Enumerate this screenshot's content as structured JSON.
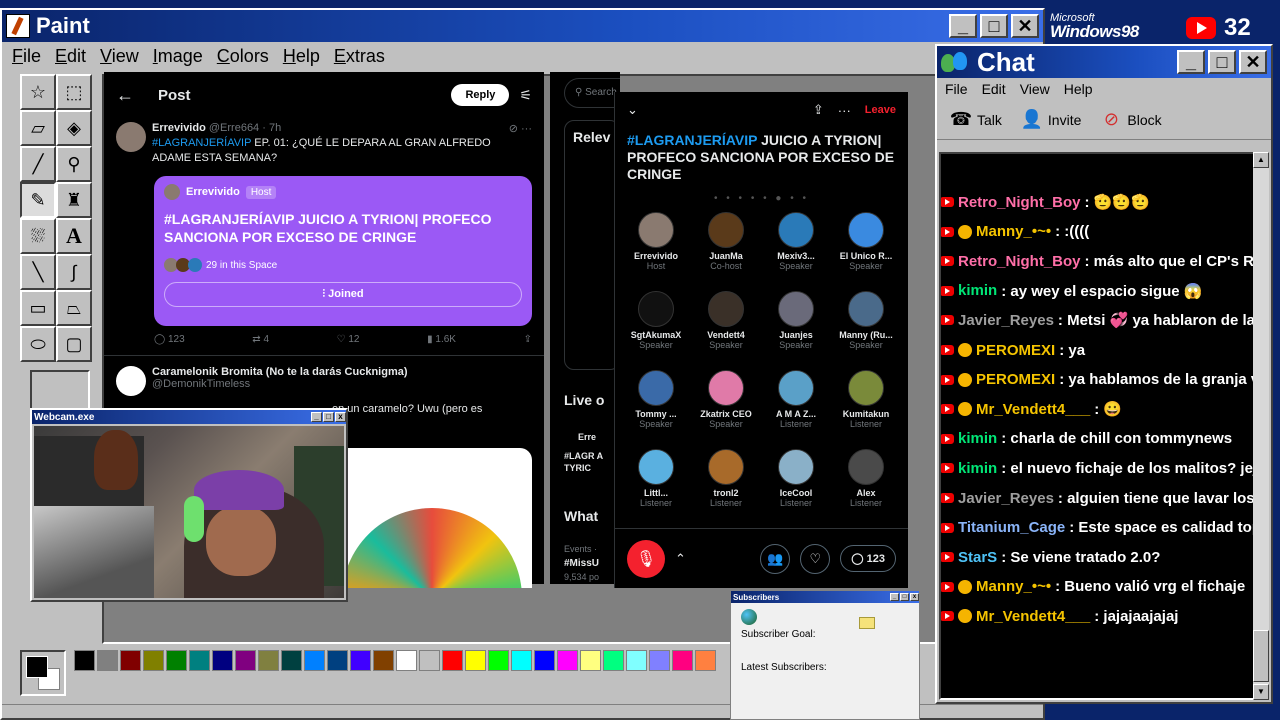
{
  "paint": {
    "title": "Paint",
    "menu": [
      "File",
      "Edit",
      "View",
      "Image",
      "Colors",
      "Help",
      "Extras"
    ],
    "tools": [
      "free-select",
      "rect-select",
      "eraser",
      "fill",
      "color-picker",
      "magnifier",
      "pencil",
      "brush",
      "airbrush",
      "text",
      "line",
      "curve",
      "rectangle",
      "polygon",
      "ellipse",
      "rounded-rect"
    ],
    "palette": [
      "#000000",
      "#808080",
      "#800000",
      "#808000",
      "#008000",
      "#008080",
      "#000080",
      "#800080",
      "#808040",
      "#004040",
      "#0080ff",
      "#004080",
      "#4000ff",
      "#804000",
      "#ffffff",
      "#c0c0c0",
      "#ff0000",
      "#ffff00",
      "#00ff00",
      "#00ffff",
      "#0000ff",
      "#ff00ff",
      "#ffff80",
      "#00ff80",
      "#80ffff",
      "#8080ff",
      "#ff0080",
      "#ff8040"
    ]
  },
  "x_post": {
    "header_title": "Post",
    "reply_label": "Reply",
    "tweet1": {
      "name": "Errevivido",
      "handle": "@Erre664 · 7h",
      "tag": "#LAGRANJERÍAVIP",
      "text": " EP. 01: ¿QUÉ LE DEPARA AL GRAN ALFREDO ADAME ESTA SEMANA?",
      "card_host": "Errevivido",
      "card_host_badge": "Host",
      "card_title": "#LAGRANJERÍAVIP JUICIO A TYRION| PROFECO SANCIONA POR EXCESO DE CRINGE",
      "card_listeners": "29 in this Space",
      "card_joined": "Joined",
      "actions": [
        "123",
        "4",
        "12",
        "1.6K"
      ]
    },
    "tweet2": {
      "name": "Caramelonik Bromita (No te la darás Cucknigma)",
      "handle": "@DemonikTimeless",
      "text": "en un caramelo? Uwu (pero es"
    }
  },
  "x_right": {
    "search": "Search",
    "box1": "Relev",
    "box2": "Live o",
    "box2_name": "Erre",
    "box2_text": "#LAGR A TYRIC",
    "box3": "What",
    "box3_sub": "Events ·",
    "box3_tag": "#MissU",
    "box3_count": "9,534 po"
  },
  "space": {
    "leave": "Leave",
    "tag": "#LAGRANJERÍAVIP",
    "title": " JUICIO A TYRION| PROFECO SANCIONA POR EXCESO DE CRINGE",
    "dots": "• • • • • ● • •",
    "participants": [
      {
        "name": "Errevivido",
        "role": "Host",
        "color": "#8a7a70"
      },
      {
        "name": "JuanMa",
        "role": "Co-host",
        "color": "#5a3a1a"
      },
      {
        "name": "Mexiv3...",
        "role": "Speaker",
        "color": "#2a7ab8"
      },
      {
        "name": "El Unico R...",
        "role": "Speaker",
        "color": "#3a8ae0"
      },
      {
        "name": "SgtAkumaX",
        "role": "Speaker",
        "color": "#111111"
      },
      {
        "name": "Vendett4",
        "role": "Speaker",
        "color": "#3a3028"
      },
      {
        "name": "Juanjes",
        "role": "Speaker",
        "color": "#6a6a7a"
      },
      {
        "name": "Manny (Ru...",
        "role": "Speaker",
        "color": "#4a6a8a"
      },
      {
        "name": "Tommy ...",
        "role": "Speaker",
        "color": "#3a6aa8"
      },
      {
        "name": "Zkatrix CEO",
        "role": "Speaker",
        "color": "#e07aa8"
      },
      {
        "name": "A M A Z...",
        "role": "Listener",
        "color": "#5aa0c8"
      },
      {
        "name": "Kumitakun",
        "role": "Listener",
        "color": "#7a8a3a"
      },
      {
        "name": "Littl...",
        "role": "Listener",
        "color": "#5ab0e0"
      },
      {
        "name": "tronl2",
        "role": "Listener",
        "color": "#a86a2a"
      },
      {
        "name": "IceCool",
        "role": "Listener",
        "color": "#8ab0c8"
      },
      {
        "name": "Alex",
        "role": "Listener",
        "color": "#4a4a4a"
      }
    ],
    "count": "123"
  },
  "webcam": {
    "title": "Webcam.exe"
  },
  "chat": {
    "title": "Chat",
    "menu": [
      "File",
      "Edit",
      "View",
      "Help"
    ],
    "tools": [
      "Talk",
      "Invite",
      "Block"
    ],
    "messages": [
      {
        "user": "Retro_Night_Boy",
        "text": ": 🫡🫡🫡",
        "color": "#ff6fa8",
        "badge": false
      },
      {
        "user": "Manny_•~•",
        "text": ": :((((",
        "color": "#f5c400",
        "badge": true
      },
      {
        "user": "Retro_Night_Boy",
        "text": ": más alto que el CP's Reviwe",
        "color": "#ff6fa8",
        "badge": false
      },
      {
        "user": "kimin",
        "text": ": ay wey el espacio sigue 😱",
        "color": "#00e676",
        "badge": false
      },
      {
        "user": "Javier_Reyes",
        "text": ": Metsi 💞 ya hablaron de la gra",
        "color": "#9e9e9e",
        "badge": false
      },
      {
        "user": "PEROMEXI",
        "text": ": ya",
        "color": "#f5c400",
        "badge": true
      },
      {
        "user": "PEROMEXI",
        "text": ": ya hablamos de la granja vip",
        "color": "#f5c400",
        "badge": true
      },
      {
        "user": "Mr_Vendett4___",
        "text": ": 😀",
        "color": "#f5c400",
        "badge": true
      },
      {
        "user": "kimin",
        "text": ": charla de chill con tommynews",
        "color": "#00e676",
        "badge": false
      },
      {
        "user": "kimin",
        "text": ": el nuevo fichaje de los malitos? jeje",
        "color": "#00e676",
        "badge": false
      },
      {
        "user": "Javier_Reyes",
        "text": ": alguien tiene que lavar los unifo",
        "color": "#9e9e9e",
        "badge": false
      },
      {
        "user": "Titanium_Cage",
        "text": ": Este space es calidad top",
        "color": "#8ab4f8",
        "badge": false
      },
      {
        "user": "StarS",
        "text": ": Se viene tratado 2.0?",
        "color": "#4fc3f7",
        "badge": false
      },
      {
        "user": "Manny_•~•",
        "text": ": Bueno valió vrg el fichaje",
        "color": "#f5c400",
        "badge": true
      },
      {
        "user": "Mr_Vendett4___",
        "text": ": jajajaajajaj",
        "color": "#f5c400",
        "badge": true
      }
    ]
  },
  "branding": {
    "ms": "Microsoft",
    "win": "Windows98",
    "yt_count": "32"
  },
  "subscribers": {
    "title": "Subscribers",
    "goal": "Subscriber Goal:",
    "latest": "Latest Subscribers:"
  }
}
